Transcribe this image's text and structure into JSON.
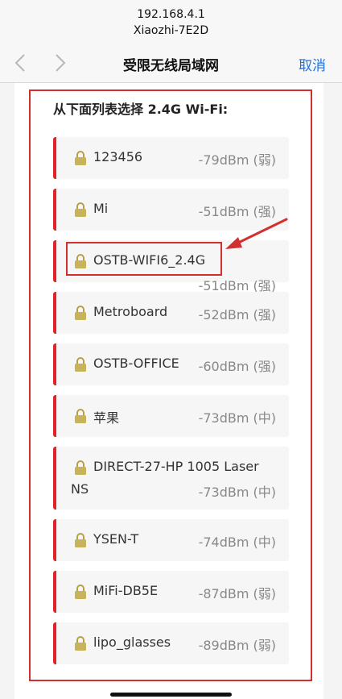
{
  "browser": {
    "host_ip": "192.168.4.1",
    "host_name": "Xiaozhi-7E2D",
    "title": "受限无线局域网",
    "cancel_label": "取消"
  },
  "list": {
    "heading": "从下面列表选择 2.4G Wi-Fi:"
  },
  "networks": [
    {
      "ssid": "123456",
      "signal": "-79dBm (弱)"
    },
    {
      "ssid": "Mi",
      "signal": "-51dBm (强)"
    },
    {
      "ssid": "OSTB-WIFI6_2.4G",
      "signal": "-51dBm (强)"
    },
    {
      "ssid": "Metroboard",
      "signal": "-52dBm (强)"
    },
    {
      "ssid": "OSTB-OFFICE",
      "signal": "-60dBm (强)"
    },
    {
      "ssid": "苹果",
      "signal": "-73dBm (中)"
    },
    {
      "ssid": "DIRECT-27-HP 1005 Laser",
      "ssid_line2": "NS",
      "signal": "-73dBm (中)"
    },
    {
      "ssid": "YSEN-T",
      "signal": "-74dBm (中)"
    },
    {
      "ssid": "MiFi-DB5E",
      "signal": "-87dBm (弱)"
    },
    {
      "ssid": "lipo_glasses",
      "signal": "-89dBm (弱)"
    }
  ],
  "colors": {
    "accent_red": "#e0232a",
    "link_blue": "#1a73e8"
  },
  "icons": {
    "lock": "lock-icon",
    "back": "chevron-left-icon",
    "forward": "chevron-right-icon"
  }
}
